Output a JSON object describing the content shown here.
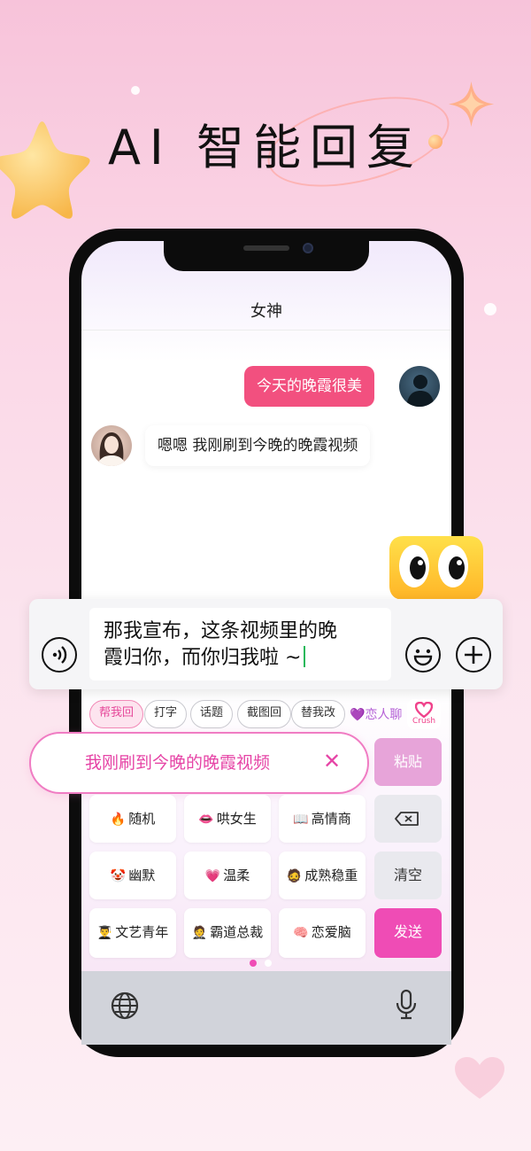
{
  "headline": "AI 智能回复",
  "chat": {
    "title": "女神",
    "messages": [
      {
        "side": "right",
        "text": "今天的晚霞很美"
      },
      {
        "side": "left",
        "text": "嗯嗯  我刚刷到今晚的晚霞视频"
      }
    ]
  },
  "input": {
    "line1": "那我宣布，这条视频里的晚",
    "line2": "霞归你，而你归我啦 ~"
  },
  "suggestion_tabs": [
    "帮我回",
    "打字",
    "话题",
    "截图回",
    "替我改"
  ],
  "active_tab": "帮我回",
  "lover_chat_label": "恋人聊",
  "crush_label": "Crush",
  "quoted_message": "我刚刷到今晚的晚霞视频",
  "style_keys": [
    {
      "emoji": "🔥",
      "label": "随机"
    },
    {
      "emoji": "👄",
      "label": "哄女生"
    },
    {
      "emoji": "📖",
      "label": "高情商"
    },
    {
      "emoji": "🤡",
      "label": "幽默"
    },
    {
      "emoji": "💗",
      "label": "温柔"
    },
    {
      "emoji": "🧔",
      "label": "成熟稳重"
    },
    {
      "emoji": "👨‍🎓",
      "label": "文艺青年"
    },
    {
      "emoji": "🤵",
      "label": "霸道总裁"
    },
    {
      "emoji": "🧠",
      "label": "恋爱脑"
    }
  ],
  "side_keys": {
    "paste": "粘贴",
    "clear": "清空",
    "send": "发送"
  },
  "page_indicator": {
    "count": 2,
    "active": 1
  },
  "colors": {
    "accent_pink": "#ef4cb5",
    "bubble_pink": "#f2507f",
    "quote_pink": "#e644a6"
  },
  "icons": [
    "star-icon",
    "sparkle-icon",
    "voice-icon",
    "emoji-icon",
    "plus-icon",
    "backspace-icon",
    "globe-icon",
    "microphone-icon",
    "close-icon",
    "heart-icon"
  ]
}
